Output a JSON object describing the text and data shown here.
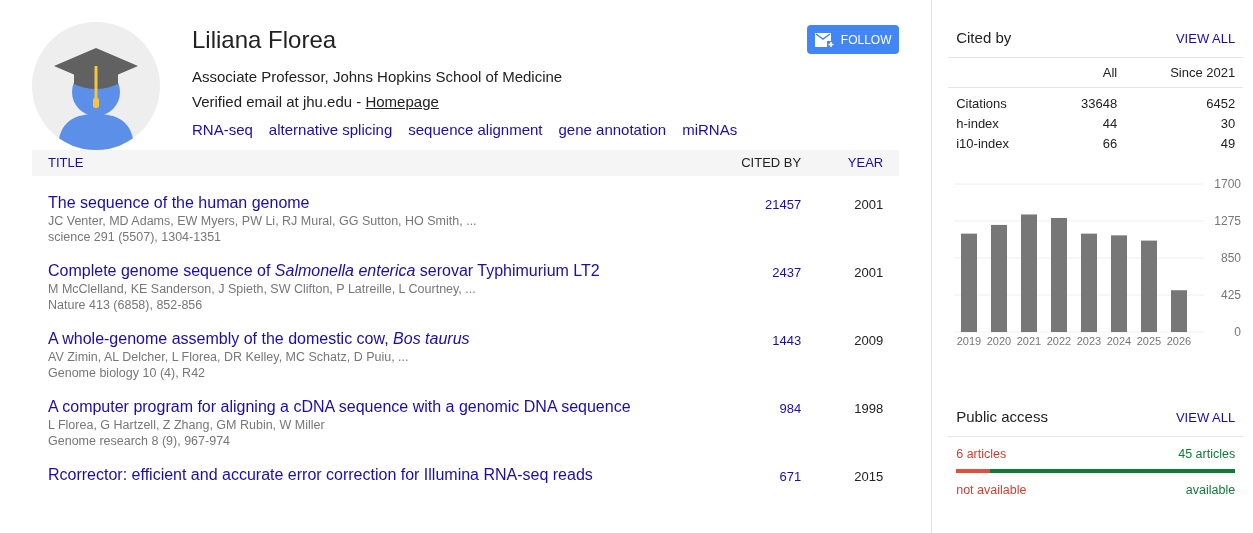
{
  "profile": {
    "name": "Liliana Florea",
    "affiliation": "Associate Professor, Johns Hopkins School of Medicine",
    "email": "Verified email at jhu.edu - ",
    "homepage": "Homepage",
    "interests": [
      "RNA-seq",
      "alternative splicing",
      "sequence alignment",
      "gene annotation",
      "miRNAs"
    ],
    "follow": "FOLLOW"
  },
  "table": {
    "columns": [
      "TITLE",
      "CITED BY",
      "YEAR"
    ],
    "rows": [
      {
        "title": "The sequence of the human genome",
        "authors": "JC Venter, MD Adams, EW Myers, PW Li, RJ Mural, GG Sutton, HO Smith, ...",
        "venue": "science 291 (5507), 1304-1351",
        "cited_by": "21457",
        "year": "2001"
      },
      {
        "title": "Complete genome sequence of *Salmonella enterica* serovar Typhimurium LT2",
        "authors": "M McClelland, KE Sanderson, J Spieth, SW Clifton, P Latreille, L Courtney, ...",
        "venue": "Nature 413 (6858), 852-856",
        "cited_by": "2437",
        "year": "2001"
      },
      {
        "title": "A whole-genome assembly of the domestic cow, *Bos taurus*",
        "authors": "AV Zimin, AL Delcher, L Florea, DR Kelley, MC Schatz, D Puiu, ...",
        "venue": "Genome biology 10 (4), R42",
        "cited_by": "1443",
        "year": "2009"
      },
      {
        "title": "A computer program for aligning a cDNA sequence with a genomic DNA sequence",
        "authors": "L Florea, G Hartzell, Z Zhang, GM Rubin, W Miller",
        "venue": "Genome research 8 (9), 967-974",
        "cited_by": "984",
        "year": "1998"
      },
      {
        "title": "Rcorrector: efficient and accurate error correction for Illumina RNA-seq reads",
        "cited_by": "671",
        "year": "2015"
      }
    ]
  },
  "cited_by": {
    "title": "Cited by",
    "view_all": "VIEW ALL",
    "columns": [
      "All",
      "Since 2021"
    ],
    "rows": [
      {
        "label": "Citations",
        "all": "33648",
        "since": "6452"
      },
      {
        "label": "h-index",
        "all": "44",
        "since": "30"
      },
      {
        "label": "i10-index",
        "all": "66",
        "since": "49"
      }
    ],
    "chart_data": {
      "type": "bar",
      "categories": [
        "2019",
        "2020",
        "2021",
        "2022",
        "2023",
        "2024",
        "2025",
        "2026"
      ],
      "values": [
        1130,
        1230,
        1350,
        1310,
        1130,
        1110,
        1050,
        480
      ],
      "grid": true,
      "ylim": [
        0,
        1700
      ],
      "yticks": [
        0,
        425,
        850,
        1275,
        1700
      ]
    }
  },
  "public_access": {
    "title": "Public access",
    "view_all": "VIEW ALL",
    "not_available_count": "6 articles",
    "available_count": "45 articles",
    "not_available": "not available",
    "available": "available",
    "level": 0.12
  }
}
